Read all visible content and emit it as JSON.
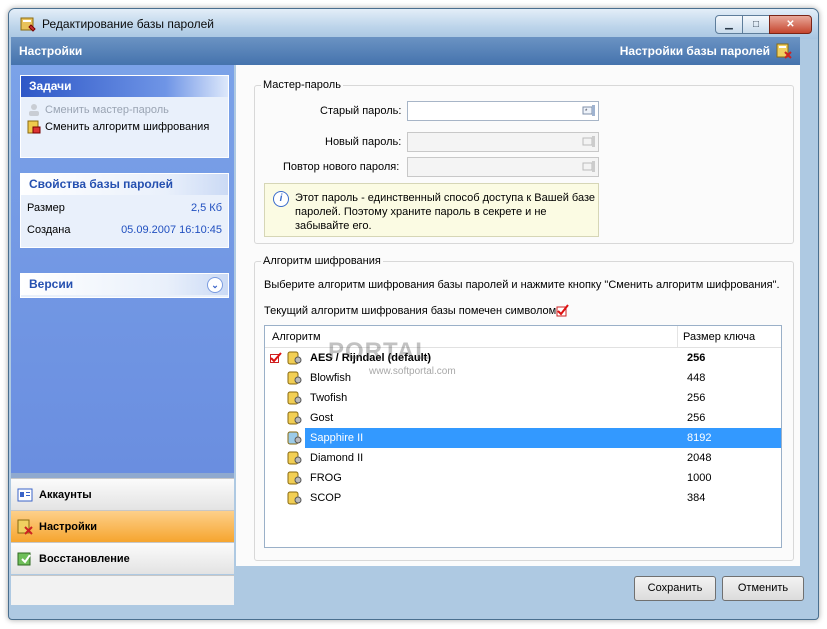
{
  "window": {
    "title": "Редактирование базы паролей"
  },
  "header": {
    "left": "Настройки",
    "right": "Настройки базы паролей"
  },
  "tasks": {
    "title": "Задачи",
    "items": [
      {
        "label": "Сменить мастер-пароль",
        "enabled": false
      },
      {
        "label": "Сменить алгоритм шифрования",
        "enabled": true
      }
    ]
  },
  "properties": {
    "title": "Свойства базы паролей",
    "size_label": "Размер",
    "size_value": "2,5 Кб",
    "created_label": "Создана",
    "created_value": "05.09.2007 16:10:45"
  },
  "versions": {
    "title": "Версии"
  },
  "nav": [
    {
      "label": "Аккаунты",
      "active": false
    },
    {
      "label": "Настройки",
      "active": true
    },
    {
      "label": "Восстановление",
      "active": false
    }
  ],
  "master": {
    "group_title": "Мастер-пароль",
    "old_label": "Старый пароль:",
    "new_label": "Новый пароль:",
    "repeat_label": "Повтор нового пароля:",
    "info": "Этот пароль - единственный способ доступа к Вашей базе паролей. Поэтому храните пароль в секрете и не забывайте его."
  },
  "algo": {
    "group_title": "Алгоритм шифрования",
    "instruction": "Выберите алгоритм шифрования базы паролей и нажмите кнопку \"Сменить алгоритм шифрования\".",
    "current_note": "Текущий алгоритм шифрования базы помечен символом:",
    "col_algo": "Алгоритм",
    "col_key": "Размер ключа",
    "rows": [
      {
        "name": "AES / Rijndael (default)",
        "key": "256",
        "current": true,
        "selected": false
      },
      {
        "name": "Blowfish",
        "key": "448",
        "current": false,
        "selected": false
      },
      {
        "name": "Twofish",
        "key": "256",
        "current": false,
        "selected": false
      },
      {
        "name": "Gost",
        "key": "256",
        "current": false,
        "selected": false
      },
      {
        "name": "Sapphire II",
        "key": "8192",
        "current": false,
        "selected": true
      },
      {
        "name": "Diamond II",
        "key": "2048",
        "current": false,
        "selected": false
      },
      {
        "name": "FROG",
        "key": "1000",
        "current": false,
        "selected": false
      },
      {
        "name": "SCOP",
        "key": "384",
        "current": false,
        "selected": false
      }
    ]
  },
  "buttons": {
    "save": "Сохранить",
    "cancel": "Отменить"
  },
  "watermark": {
    "big": "PORTAL",
    "small": "www.softportal.com"
  },
  "colors": {
    "selection": "#3399ff",
    "active_nav": "#f6a52f",
    "header": "#4573ad"
  }
}
